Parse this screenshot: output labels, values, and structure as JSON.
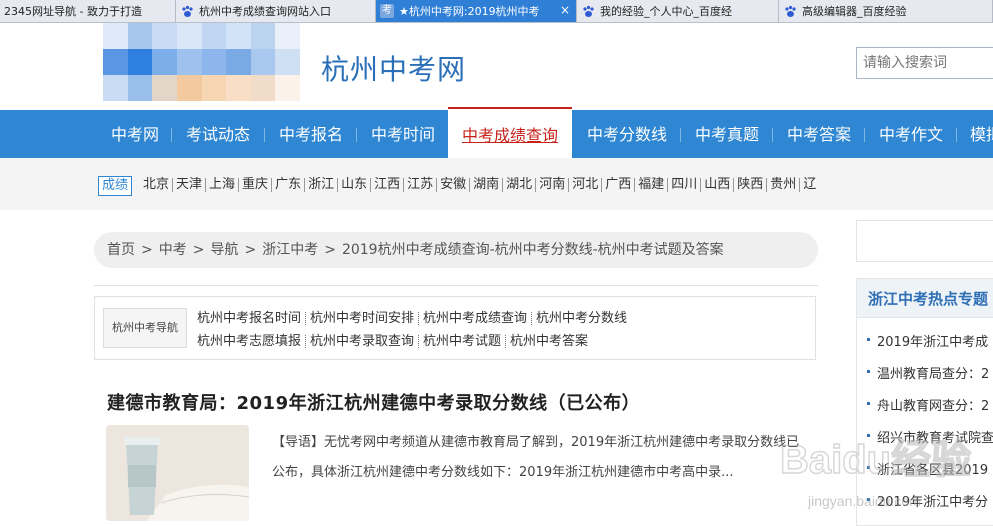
{
  "tabs": [
    {
      "label": "2345网址导航 - 致力于打造",
      "favicon": "none",
      "active": false
    },
    {
      "label": "杭州中考成绩查询网站入口",
      "favicon": "baidu-paw-icon",
      "active": false
    },
    {
      "label": "★杭州中考网:2019杭州中考",
      "favicon": "zhongkao-icon",
      "favicon_text": "考",
      "active": true,
      "close": "×"
    },
    {
      "label": "我的经验_个人中心_百度经",
      "favicon": "baidu-paw-icon",
      "active": false
    },
    {
      "label": "高级编辑器_百度经验",
      "favicon": "baidu-paw-icon",
      "active": false
    }
  ],
  "header": {
    "site_title": "杭州中考网",
    "search_placeholder": "请输入搜索词"
  },
  "mainnav": [
    {
      "label": "中考网"
    },
    {
      "label": "考试动态"
    },
    {
      "label": "中考报名"
    },
    {
      "label": "中考时间"
    },
    {
      "label": "中考成绩查询",
      "active": true
    },
    {
      "label": "中考分数线"
    },
    {
      "label": "中考真题"
    },
    {
      "label": "中考答案"
    },
    {
      "label": "中考作文"
    },
    {
      "label": "模拟"
    }
  ],
  "regionbar": {
    "badge": "成绩",
    "regions": [
      "北京",
      "天津",
      "上海",
      "重庆",
      "广东",
      "浙江",
      "山东",
      "江西",
      "江苏",
      "安徽",
      "湖南",
      "湖北",
      "河南",
      "河北",
      "广西",
      "福建",
      "四川",
      "山西",
      "陕西",
      "贵州",
      "辽"
    ]
  },
  "breadcrumb": [
    "首页",
    "中考",
    "导航",
    "浙江中考",
    "2019杭州中考成绩查询-杭州中考分数线-杭州中考试题及答案"
  ],
  "breadcrumb_sep": ">",
  "subnav": {
    "label": "杭州中考导航",
    "row1": [
      "杭州中考报名时间",
      "杭州中考时间安排",
      "杭州中考成绩查询",
      "杭州中考分数线"
    ],
    "row2": [
      "杭州中考志愿填报",
      "杭州中考录取查询",
      "杭州中考试题",
      "杭州中考答案"
    ]
  },
  "article": {
    "title": "建德市教育局：2019年浙江杭州建德中考录取分数线（已公布）",
    "summary": "【导语】无忧考网中考频道从建德市教育局了解到，2019年浙江杭州建德中考录取分数线已公布，具体浙江杭州建德中考分数线如下：2019年浙江杭州建德市中考高中录..."
  },
  "sidebar": {
    "heading": "浙江中考热点专题",
    "items": [
      "2019年浙江中考成",
      "温州教育局查分：2",
      "舟山教育网查分：2",
      "绍兴市教育考试院查",
      "浙江省各区县2019",
      "2019年浙江中考分"
    ]
  },
  "watermark": {
    "brand": "Baidu经验",
    "url": "jingyan.baidu.com"
  },
  "colors": {
    "nav_blue": "#2f86d2",
    "active_red": "#c7231b",
    "title_blue": "#2a6fb8",
    "tab_active": "#2f7fd7"
  }
}
